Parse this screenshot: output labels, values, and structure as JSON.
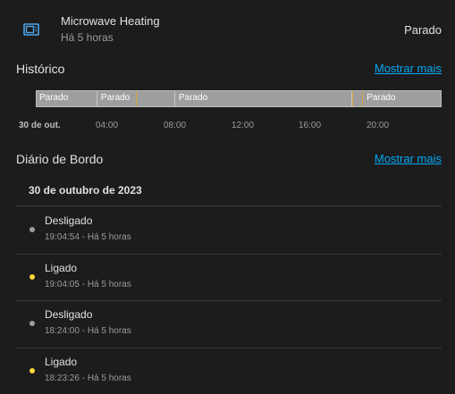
{
  "entity": {
    "name": "Microwave Heating",
    "relative_time": "Há 5 horas",
    "state": "Parado",
    "icon": "microwave-icon"
  },
  "history": {
    "title": "Histórico",
    "show_more": "Mostrar mais",
    "segments": [
      {
        "label": "Parado",
        "start": "00:00",
        "end": "03:25"
      },
      {
        "label": "Parado",
        "start": "03:25",
        "end": "08:00"
      },
      {
        "label": "Parado",
        "start": "08:00",
        "end": "18:24"
      },
      {
        "label": "",
        "start": "18:24",
        "end": "19:04"
      },
      {
        "label": "Parado",
        "start": "19:04",
        "end": "24:00"
      }
    ],
    "ticks": [
      "30 de out.",
      "04:00",
      "08:00",
      "12:00",
      "16:00",
      "20:00"
    ],
    "bar_color": "#9e9e9e",
    "marker_color": "#d4a53a"
  },
  "logbook": {
    "title": "Diário de Bordo",
    "show_more": "Mostrar mais",
    "date": "30 de outubro de 2023",
    "entries": [
      {
        "state": "Desligado",
        "time": "19:04:54 - Há 5 horas",
        "dot_color": "#9e9e9e"
      },
      {
        "state": "Ligado",
        "time": "19:04:05 - Há 5 horas",
        "dot_color": "#fdd835"
      },
      {
        "state": "Desligado",
        "time": "18:24:00 - Há 5 horas",
        "dot_color": "#9e9e9e"
      },
      {
        "state": "Ligado",
        "time": "18:23:26 - Há 5 horas",
        "dot_color": "#fdd835"
      }
    ]
  }
}
